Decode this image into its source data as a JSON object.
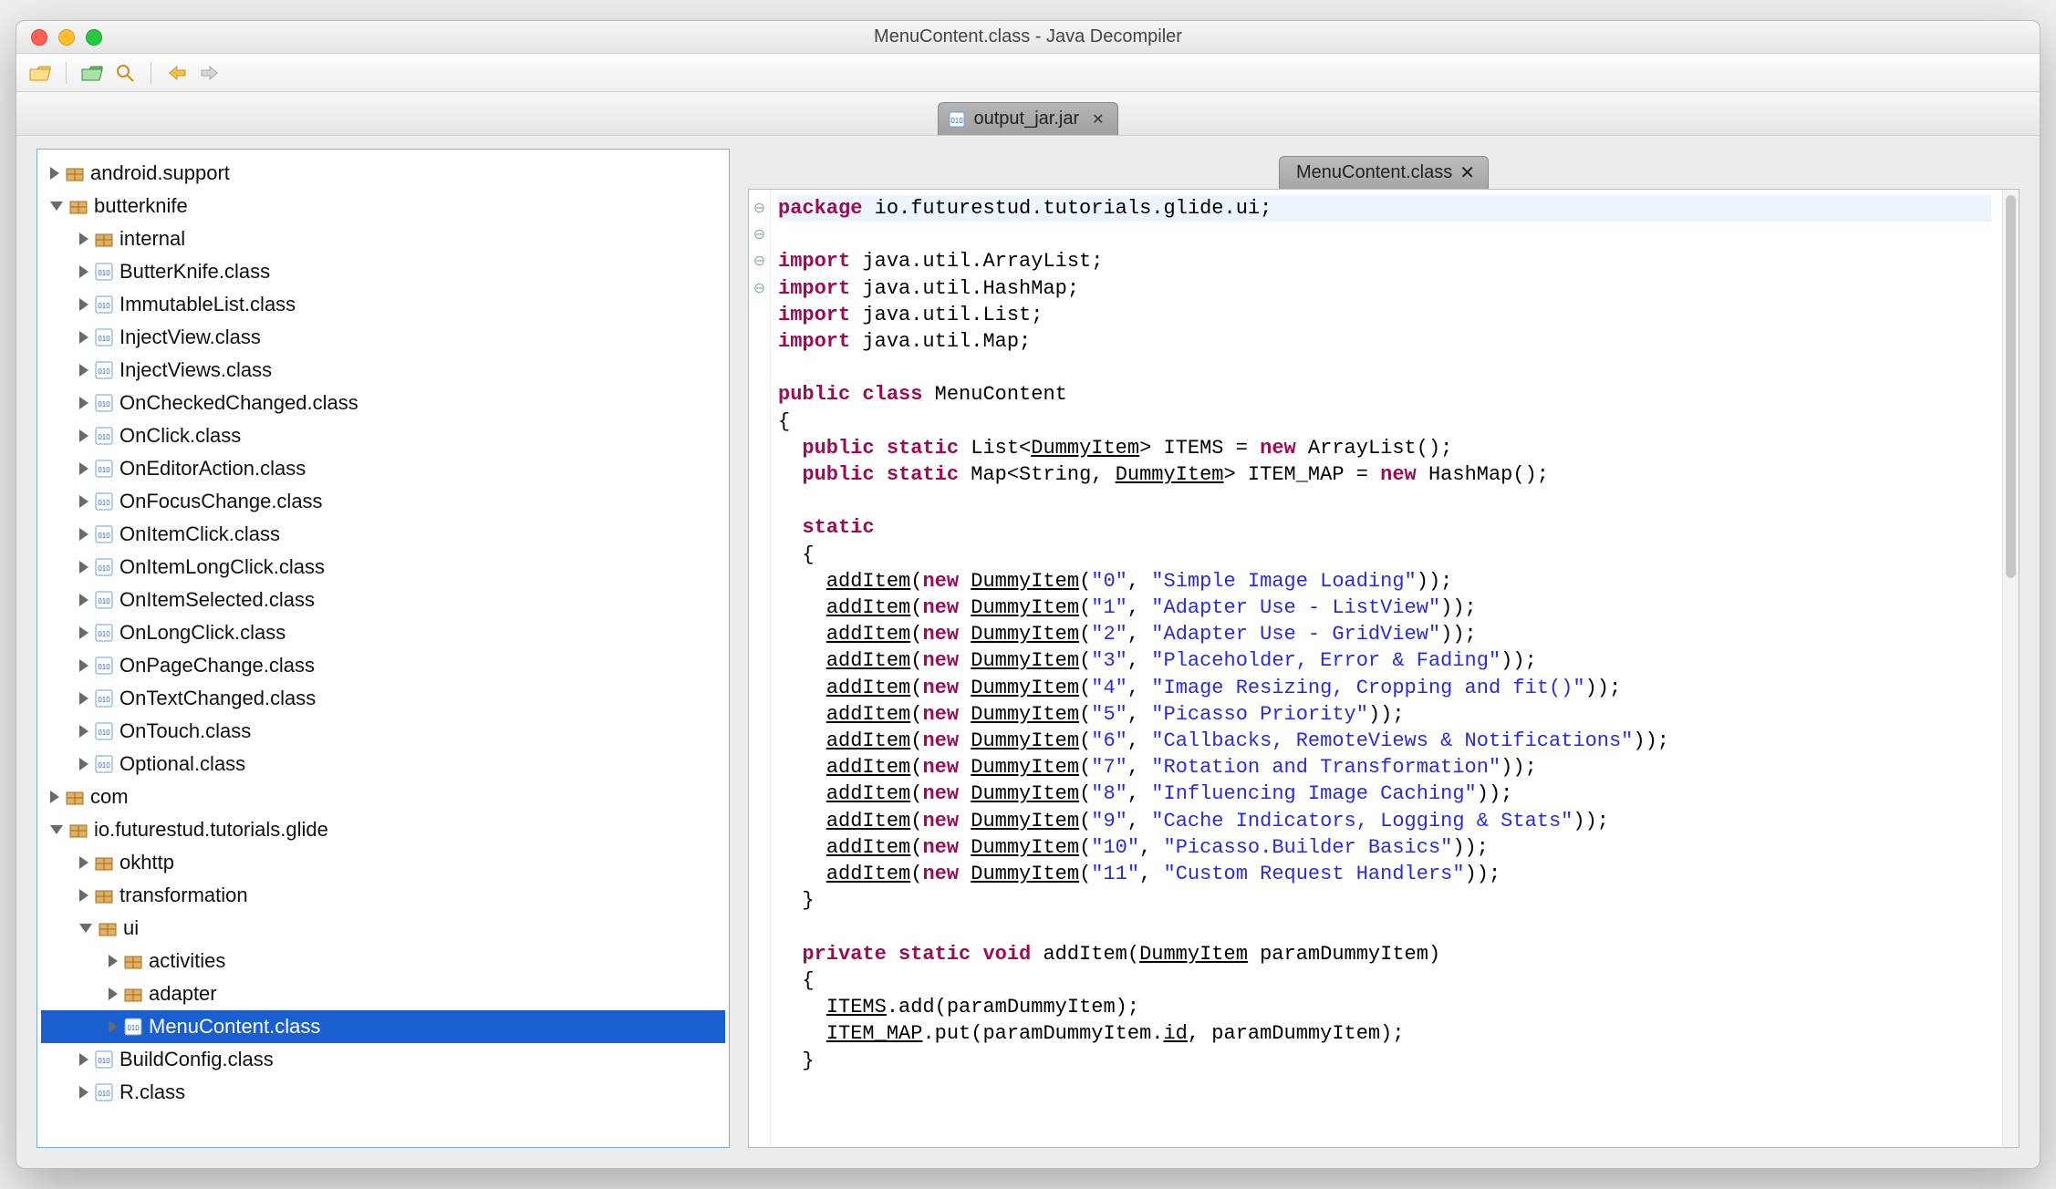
{
  "window_title": "MenuContent.class - Java Decompiler",
  "project_tab": {
    "label": "output_jar.jar"
  },
  "editor_tab": {
    "label": "MenuContent.class"
  },
  "tree": [
    {
      "ind": 0,
      "disc": "closed",
      "icon": "pkg",
      "label": "android.support"
    },
    {
      "ind": 0,
      "disc": "open",
      "icon": "pkg",
      "label": "butterknife"
    },
    {
      "ind": 1,
      "disc": "closed",
      "icon": "pkg",
      "label": "internal"
    },
    {
      "ind": 1,
      "disc": "closed",
      "icon": "cls",
      "label": "ButterKnife.class"
    },
    {
      "ind": 1,
      "disc": "closed",
      "icon": "cls",
      "label": "ImmutableList.class"
    },
    {
      "ind": 1,
      "disc": "closed",
      "icon": "cls",
      "label": "InjectView.class"
    },
    {
      "ind": 1,
      "disc": "closed",
      "icon": "cls",
      "label": "InjectViews.class"
    },
    {
      "ind": 1,
      "disc": "closed",
      "icon": "cls",
      "label": "OnCheckedChanged.class"
    },
    {
      "ind": 1,
      "disc": "closed",
      "icon": "cls",
      "label": "OnClick.class"
    },
    {
      "ind": 1,
      "disc": "closed",
      "icon": "cls",
      "label": "OnEditorAction.class"
    },
    {
      "ind": 1,
      "disc": "closed",
      "icon": "cls",
      "label": "OnFocusChange.class"
    },
    {
      "ind": 1,
      "disc": "closed",
      "icon": "cls",
      "label": "OnItemClick.class"
    },
    {
      "ind": 1,
      "disc": "closed",
      "icon": "cls",
      "label": "OnItemLongClick.class"
    },
    {
      "ind": 1,
      "disc": "closed",
      "icon": "cls",
      "label": "OnItemSelected.class"
    },
    {
      "ind": 1,
      "disc": "closed",
      "icon": "cls",
      "label": "OnLongClick.class"
    },
    {
      "ind": 1,
      "disc": "closed",
      "icon": "cls",
      "label": "OnPageChange.class"
    },
    {
      "ind": 1,
      "disc": "closed",
      "icon": "cls",
      "label": "OnTextChanged.class"
    },
    {
      "ind": 1,
      "disc": "closed",
      "icon": "cls",
      "label": "OnTouch.class"
    },
    {
      "ind": 1,
      "disc": "closed",
      "icon": "cls",
      "label": "Optional.class"
    },
    {
      "ind": 0,
      "disc": "closed",
      "icon": "pkg",
      "label": "com"
    },
    {
      "ind": 0,
      "disc": "open",
      "icon": "pkg",
      "label": "io.futurestud.tutorials.glide"
    },
    {
      "ind": 1,
      "disc": "closed",
      "icon": "pkg",
      "label": "okhttp"
    },
    {
      "ind": 1,
      "disc": "closed",
      "icon": "pkg",
      "label": "transformation"
    },
    {
      "ind": 1,
      "disc": "open",
      "icon": "pkg",
      "label": "ui"
    },
    {
      "ind": 2,
      "disc": "closed",
      "icon": "pkg",
      "label": "activities"
    },
    {
      "ind": 2,
      "disc": "closed",
      "icon": "pkg",
      "label": "adapter"
    },
    {
      "ind": 2,
      "disc": "closed",
      "icon": "cls",
      "label": "MenuContent.class",
      "selected": true
    },
    {
      "ind": 1,
      "disc": "closed",
      "icon": "cls",
      "label": "BuildConfig.class"
    },
    {
      "ind": 1,
      "disc": "closed",
      "icon": "cls",
      "label": "R.class"
    }
  ],
  "code": {
    "package_kw": "package",
    "package_name": " io.futurestud.tutorials.glide.ui;",
    "import_kw": "import",
    "imports": [
      " java.util.ArrayList;",
      " java.util.HashMap;",
      " java.util.List;",
      " java.util.Map;"
    ],
    "public_kw": "public",
    "class_kw": "class",
    "class_name": " MenuContent",
    "static_kw": "static",
    "new_kw": "new",
    "void_kw": "void",
    "private_kw": "private",
    "field1_pre": "  public static List<",
    "dummy": "DummyItem",
    "field1_post": "> ITEMS = ",
    "field1_tail": " ArrayList();",
    "field2_pre": "  public static Map<String, ",
    "field2_post": "> ITEM_MAP = ",
    "field2_tail": " HashMap();",
    "addItem": "addItem",
    "items": [
      {
        "id": "\"0\"",
        "title": "\"Simple Image Loading\""
      },
      {
        "id": "\"1\"",
        "title": "\"Adapter Use - ListView\""
      },
      {
        "id": "\"2\"",
        "title": "\"Adapter Use - GridView\""
      },
      {
        "id": "\"3\"",
        "title": "\"Placeholder, Error & Fading\""
      },
      {
        "id": "\"4\"",
        "title": "\"Image Resizing, Cropping and fit()\""
      },
      {
        "id": "\"5\"",
        "title": "\"Picasso Priority\""
      },
      {
        "id": "\"6\"",
        "title": "\"Callbacks, RemoteViews & Notifications\""
      },
      {
        "id": "\"7\"",
        "title": "\"Rotation and Transformation\""
      },
      {
        "id": "\"8\"",
        "title": "\"Influencing Image Caching\""
      },
      {
        "id": "\"9\"",
        "title": "\"Cache Indicators, Logging & Stats\""
      },
      {
        "id": "\"10\"",
        "title": "\"Picasso.Builder Basics\""
      },
      {
        "id": "\"11\"",
        "title": "\"Custom Request Handlers\""
      }
    ],
    "method_sig_pre": "  private static void addItem(",
    "method_sig_post": " paramDummyItem)",
    "m_line1": "    ",
    "m_items": "ITEMS",
    "m_line1b": ".add(paramDummyItem);",
    "m_line2": "    ",
    "m_itemmap": "ITEM_MAP",
    "m_line2b": ".put(paramDummyItem.",
    "m_id": "id",
    "m_line2c": ", paramDummyItem);"
  }
}
